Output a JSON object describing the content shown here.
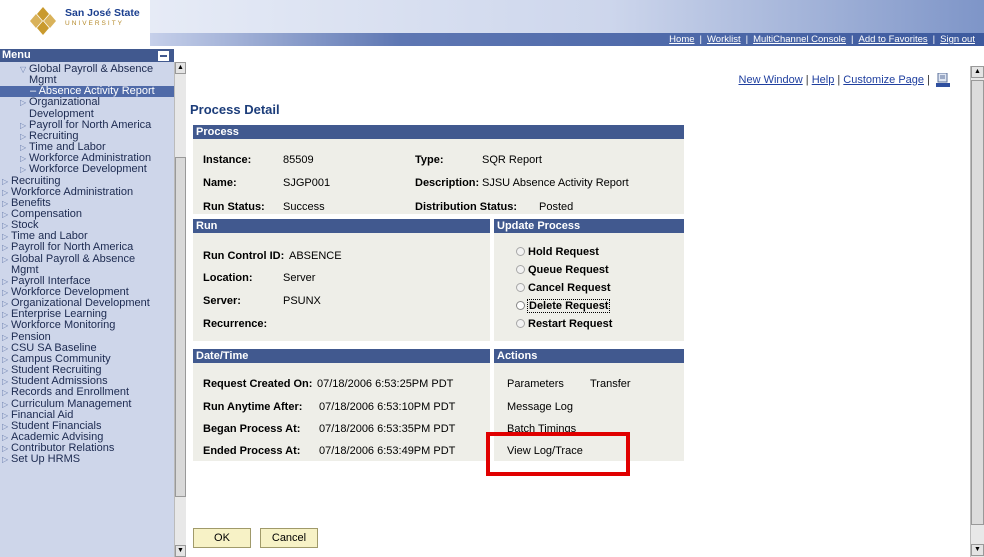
{
  "header": {
    "logo_name": "San José State",
    "logo_sub": "UNIVERSITY",
    "nav": [
      "Home",
      "Worklist",
      "MultiChannel Console",
      "Add to Favorites",
      "Sign out"
    ]
  },
  "sidebar": {
    "title": "Menu",
    "items": [
      {
        "label": "Global Payroll & Absence",
        "level": 1,
        "icon": "triangle-down-icon"
      },
      {
        "label": "Mgmt",
        "level": 1,
        "icon": ""
      },
      {
        "label": "– Absence Activity Report",
        "level": 2,
        "icon": "",
        "active": true
      },
      {
        "label": "Organizational",
        "level": 1,
        "icon": "triangle-right-icon"
      },
      {
        "label": "Development",
        "level": 1,
        "icon": ""
      },
      {
        "label": "Payroll for North America",
        "level": 1,
        "icon": "triangle-right-icon"
      },
      {
        "label": "Recruiting",
        "level": 1,
        "icon": "triangle-right-icon"
      },
      {
        "label": "Time and Labor",
        "level": 1,
        "icon": "triangle-right-icon"
      },
      {
        "label": "Workforce Administration",
        "level": 1,
        "icon": "triangle-right-icon"
      },
      {
        "label": "Workforce Development",
        "level": 1,
        "icon": "triangle-right-icon"
      },
      {
        "label": "Recruiting",
        "level": 0,
        "icon": "triangle-right-icon"
      },
      {
        "label": "Workforce Administration",
        "level": 0,
        "icon": "triangle-right-icon"
      },
      {
        "label": "Benefits",
        "level": 0,
        "icon": "triangle-right-icon"
      },
      {
        "label": "Compensation",
        "level": 0,
        "icon": "triangle-right-icon"
      },
      {
        "label": "Stock",
        "level": 0,
        "icon": "triangle-right-icon"
      },
      {
        "label": "Time and Labor",
        "level": 0,
        "icon": "triangle-right-icon"
      },
      {
        "label": "Payroll for North America",
        "level": 0,
        "icon": "triangle-right-icon"
      },
      {
        "label": "Global Payroll & Absence",
        "level": 0,
        "icon": "triangle-right-icon"
      },
      {
        "label": "Mgmt",
        "level": 0,
        "icon": ""
      },
      {
        "label": "Payroll Interface",
        "level": 0,
        "icon": "triangle-right-icon"
      },
      {
        "label": "Workforce Development",
        "level": 0,
        "icon": "triangle-right-icon"
      },
      {
        "label": "Organizational Development",
        "level": 0,
        "icon": "triangle-right-icon"
      },
      {
        "label": "Enterprise Learning",
        "level": 0,
        "icon": "triangle-right-icon"
      },
      {
        "label": "Workforce Monitoring",
        "level": 0,
        "icon": "triangle-right-icon"
      },
      {
        "label": "Pension",
        "level": 0,
        "icon": "triangle-right-icon"
      },
      {
        "label": "CSU SA Baseline",
        "level": 0,
        "icon": "triangle-right-icon"
      },
      {
        "label": "Campus Community",
        "level": 0,
        "icon": "triangle-right-icon"
      },
      {
        "label": "Student Recruiting",
        "level": 0,
        "icon": "triangle-right-icon"
      },
      {
        "label": "Student Admissions",
        "level": 0,
        "icon": "triangle-right-icon"
      },
      {
        "label": "Records and Enrollment",
        "level": 0,
        "icon": "triangle-right-icon"
      },
      {
        "label": "Curriculum Management",
        "level": 0,
        "icon": "triangle-right-icon"
      },
      {
        "label": "Financial Aid",
        "level": 0,
        "icon": "triangle-right-icon"
      },
      {
        "label": "Student Financials",
        "level": 0,
        "icon": "triangle-right-icon"
      },
      {
        "label": "Academic Advising",
        "level": 0,
        "icon": "triangle-right-icon"
      },
      {
        "label": "Contributor Relations",
        "level": 0,
        "icon": "triangle-right-icon"
      },
      {
        "label": "Set Up HRMS",
        "level": 0,
        "icon": "triangle-right-icon"
      }
    ]
  },
  "page_links": {
    "new_window": "New Window",
    "help": "Help",
    "customize": "Customize Page",
    "sep": "|",
    "http_icon": "http-icon"
  },
  "page_title": "Process Detail",
  "process": {
    "heading": "Process",
    "instance_label": "Instance:",
    "instance": "85509",
    "type_label": "Type:",
    "type": "SQR Report",
    "name_label": "Name:",
    "name": "SJGP001",
    "description_label": "Description:",
    "description": "SJSU Absence Activity Report",
    "run_status_label": "Run Status:",
    "run_status": "Success",
    "distribution_status_label": "Distribution Status:",
    "distribution_status": "Posted"
  },
  "run": {
    "heading": "Run",
    "run_control_label": "Run Control ID:",
    "run_control": "ABSENCE",
    "location_label": "Location:",
    "location": "Server",
    "server_label": "Server:",
    "server": "PSUNX",
    "recurrence_label": "Recurrence:"
  },
  "update_process": {
    "heading": "Update Process",
    "options": [
      "Hold Request",
      "Queue Request",
      "Cancel Request",
      "Delete Request",
      "Restart Request"
    ]
  },
  "datetime": {
    "heading": "Date/Time",
    "created_label": "Request Created On:",
    "created": "07/18/2006 6:53:25PM PDT",
    "anytime_label": "Run Anytime After:",
    "anytime": "07/18/2006 6:53:10PM PDT",
    "began_label": "Began Process At:",
    "began": "07/18/2006 6:53:35PM PDT",
    "ended_label": "Ended Process At:",
    "ended": "07/18/2006 6:53:49PM PDT"
  },
  "actions": {
    "heading": "Actions",
    "parameters": "Parameters",
    "transfer": "Transfer",
    "message_log": "Message Log",
    "batch_timings": "Batch Timings",
    "view_log": "View Log/Trace"
  },
  "buttons": {
    "ok": "OK",
    "cancel": "Cancel"
  },
  "colors": {
    "section_header": "#41598f",
    "menu_bg": "#ced6ea",
    "highlight": "#e00000",
    "button_bg": "#f7f2c6"
  }
}
